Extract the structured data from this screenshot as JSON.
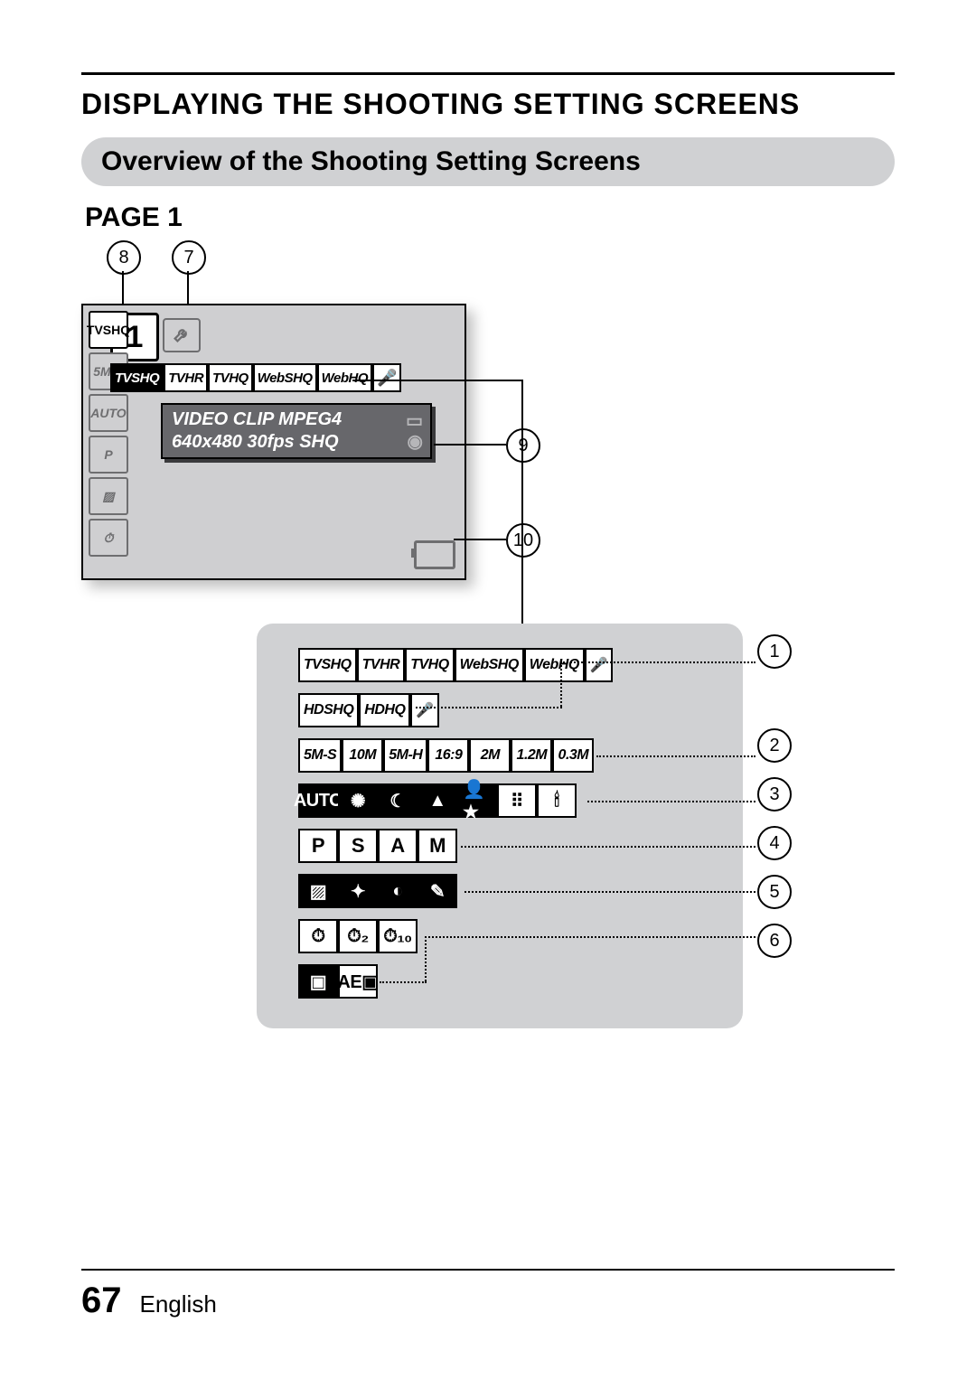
{
  "chapter_title": "DISPLAYING THE SHOOTING SETTING SCREENS",
  "section_title": "Overview of the Shooting Setting Screens",
  "page_label": "PAGE 1",
  "lcd": {
    "menu_tab": "1",
    "sidebar": [
      "TVSHQ",
      "5M-S",
      "AUTO",
      "P",
      "▨",
      "⏱"
    ],
    "row": [
      "TVSHQ",
      "TVHR",
      "TVHQ",
      "WebSHQ",
      "WebHQ",
      "🎤"
    ],
    "desc_line1": "VIDEO CLIP MPEG4",
    "desc_line2": "640x480 30fps SHQ"
  },
  "callouts": {
    "c7": "7",
    "c8": "8",
    "c9": "9",
    "c10": "10",
    "c1": "1",
    "c2": "2",
    "c3": "3",
    "c4": "4",
    "c5": "5",
    "c6": "6"
  },
  "detail_rows": {
    "r1a": [
      "TVSHQ",
      "TVHR",
      "TVHQ",
      "WebSHQ",
      "WebHQ",
      "🎤"
    ],
    "r1b": [
      "HDSHQ",
      "HDHQ",
      "🎤"
    ],
    "r2": [
      "5M-S",
      "10M",
      "5M-H",
      "16:9",
      "2M",
      "1.2M",
      "0.3M"
    ],
    "r3": [
      "AUTO",
      "✺",
      "☾",
      "▲",
      "👤★",
      "⠿",
      "🕯"
    ],
    "r4": [
      "P",
      "S",
      "A",
      "M"
    ],
    "r5": [
      "▨",
      "✦",
      "◐",
      "✎"
    ],
    "r6": [
      "⏱",
      "⏱₂",
      "⏱₁₀"
    ],
    "r7": [
      "▣",
      "AE▣"
    ]
  },
  "footer": {
    "page_number": "67",
    "language": "English"
  }
}
